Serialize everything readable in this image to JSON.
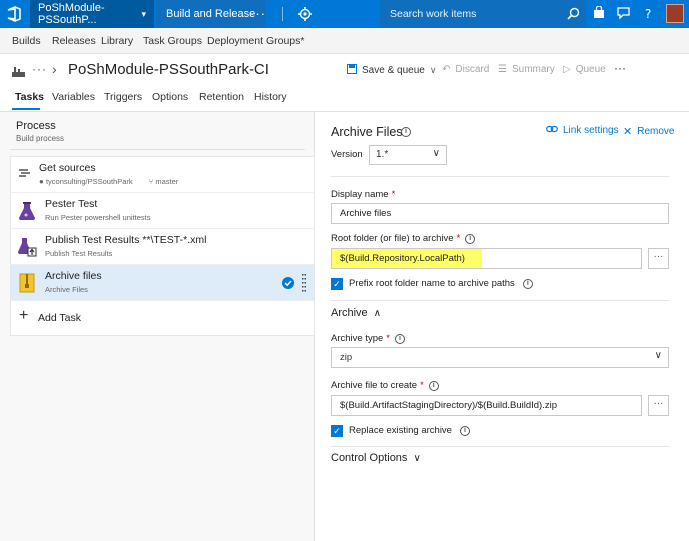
{
  "topbar": {
    "project": "PoShModule-PSSouthP...",
    "hub": "Build and Release",
    "more": "···",
    "search_placeholder": "Search work items"
  },
  "subnav": {
    "items": [
      "Builds",
      "Releases",
      "Library",
      "Task Groups",
      "Deployment Groups*"
    ]
  },
  "titlebar": {
    "breadcrumb_more": "···",
    "title": "PoShModule-PSSouthPark-CI",
    "save_queue": "Save & queue",
    "discard": "Discard",
    "summary": "Summary",
    "queue": "Queue",
    "more": "···"
  },
  "tabs": [
    "Tasks",
    "Variables",
    "Triggers",
    "Options",
    "Retention",
    "History"
  ],
  "process": {
    "title": "Process",
    "subtitle": "Build process"
  },
  "tasks": [
    {
      "title": "Get sources",
      "repo": "tyconsulting/PSSouthPark",
      "branch": "master"
    },
    {
      "title": "Pester Test",
      "subtitle": "Run Pester powershell unittests"
    },
    {
      "title": "Publish Test Results **\\TEST-*.xml",
      "subtitle": "Publish Test Results"
    },
    {
      "title": "Archive files",
      "subtitle": "Archive Files"
    }
  ],
  "add_task": "Add Task",
  "detail": {
    "title": "Archive Files",
    "link_settings": "Link settings",
    "remove": "Remove",
    "version_label": "Version",
    "version_value": "1.*",
    "display_name_label": "Display name",
    "display_name_value": "Archive files",
    "root_folder_label": "Root folder (or file) to archive",
    "root_folder_value": "$(Build.Repository.LocalPath)",
    "ellipsis": "···",
    "prefix_label": "Prefix root folder name to archive paths",
    "archive_section": "Archive",
    "archive_type_label": "Archive type",
    "archive_type_value": "zip",
    "archive_file_label": "Archive file to create",
    "archive_file_value": "$(Build.ArtifactStagingDirectory)/$(Build.BuildId).zip",
    "replace_label": "Replace existing archive",
    "control_options": "Control Options",
    "required_mark": "*",
    "info_glyph": "i"
  },
  "colors": {
    "topbar": "#0078d7",
    "accent": "#0078d7",
    "highlight": "#ffff66",
    "selected_row": "#deecf9"
  }
}
